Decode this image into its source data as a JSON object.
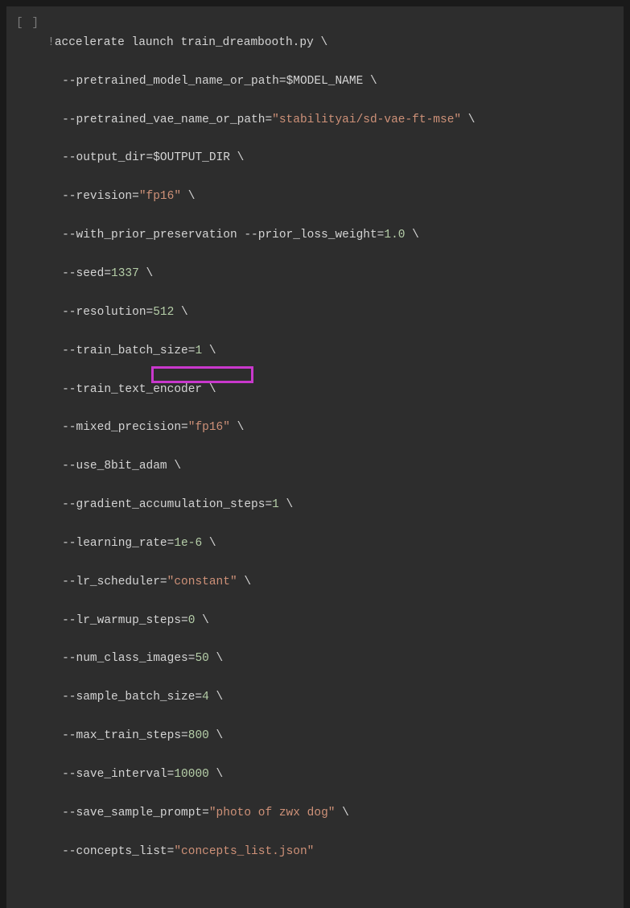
{
  "cell_prompt": "[ ]",
  "code": {
    "bang": "!",
    "l1_cmd": "accelerate launch train_dreambooth.py \\",
    "l2_flag": "--pretrained_model_name_or_path=",
    "l2_var": "$MODEL_NAME",
    "l2_end": " \\",
    "l3_flag": "--pretrained_vae_name_or_path=",
    "l3_str": "\"stabilityai/sd-vae-ft-mse\"",
    "l3_end": " \\",
    "l4_flag": "--output_dir=",
    "l4_var": "$OUTPUT_DIR",
    "l4_end": " \\",
    "l5_flag": "--revision=",
    "l5_str": "\"fp16\"",
    "l5_end": " \\",
    "l6_flag": "--with_prior_preservation --prior_loss_weight=",
    "l6_num": "1.0",
    "l6_end": " \\",
    "l7_flag": "--seed=",
    "l7_num": "1337",
    "l7_end": " \\",
    "l8_flag": "--resolution=",
    "l8_num": "512",
    "l8_end": " \\",
    "l9_flag": "--train_batch_size=",
    "l9_num": "1",
    "l9_end": " \\",
    "l10_flag": "--train_text_encoder \\",
    "l11_flag": "--mixed_precision=",
    "l11_str": "\"fp16\"",
    "l11_end": " \\",
    "l12_flag": "--use_8bit_adam \\",
    "l13_flag": "--gradient_accumulation_steps=",
    "l13_num": "1",
    "l13_end": " \\",
    "l14_flag": "--learning_rate=",
    "l14_num": "1e-6",
    "l14_end": " \\",
    "l15_flag": "--lr_scheduler=",
    "l15_str": "\"constant\"",
    "l15_end": " \\",
    "l16_flag": "--lr_warmup_steps=",
    "l16_num": "0",
    "l16_end": " \\",
    "l17_flag": "--num_class_images=",
    "l17_num": "50",
    "l17_end": " \\",
    "l18_flag": "--sample_batch_size=",
    "l18_num": "4",
    "l18_end": " \\",
    "l19_flag": "--max_train_steps=",
    "l19_num": "800",
    "l19_end": " \\",
    "l20_flag": "--save_interval=",
    "l20_num": "10000",
    "l20_end": " \\",
    "l21_flag": "--save_sample_prompt=",
    "l21_str": "\"photo of zwx dog\"",
    "l21_end": " \\",
    "l22_flag": "--concepts_list=",
    "l22_str": "\"concepts_list.json\""
  }
}
